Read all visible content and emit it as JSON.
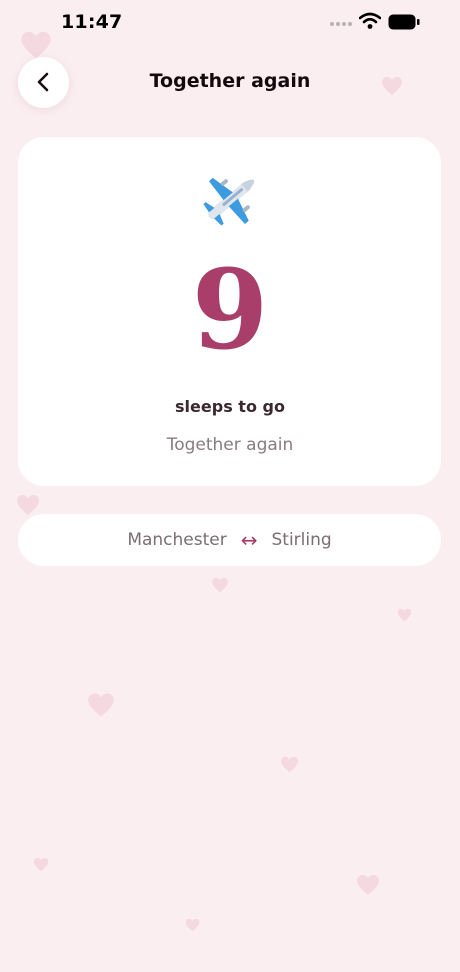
{
  "status_bar": {
    "time": "11:47"
  },
  "header": {
    "title": "Together again"
  },
  "countdown": {
    "icon": "airplane-icon",
    "number": "9",
    "unit_label": "sleeps to go",
    "event_name": "Together again"
  },
  "route": {
    "from": "Manchester",
    "separator": "↔",
    "to": "Stirling"
  },
  "colors": {
    "background": "#fbeef1",
    "accent": "#a93e6a",
    "card": "#ffffff"
  }
}
